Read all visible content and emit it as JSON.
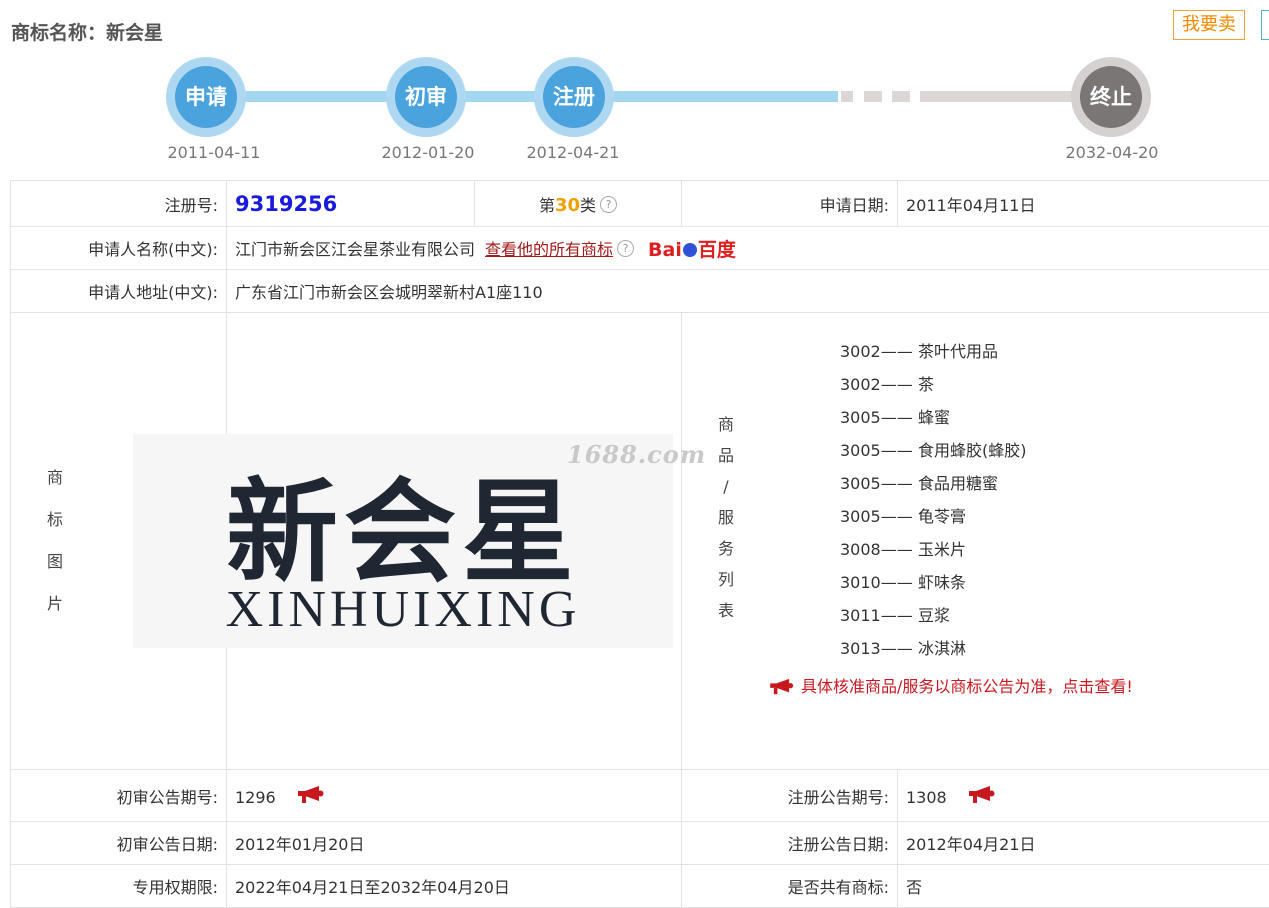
{
  "header": {
    "title": "商标名称：新会星",
    "sell_button": "我要卖"
  },
  "timeline": {
    "nodes": [
      {
        "label": "申请",
        "date": "2011-04-11",
        "state": "done"
      },
      {
        "label": "初审",
        "date": "2012-01-20",
        "state": "done"
      },
      {
        "label": "注册",
        "date": "2012-04-21",
        "state": "done"
      },
      {
        "label": "终止",
        "date": "2032-04-20",
        "state": "future"
      }
    ]
  },
  "info": {
    "reg_no_label": "注册号:",
    "reg_no": "9319256",
    "class_prefix": "第",
    "class_num": "30",
    "class_suffix": "类",
    "apply_date_label": "申请日期:",
    "apply_date": "2011年04月11日",
    "applicant_label": "申请人名称(中文):",
    "applicant": "江门市新会区江会星茶业有限公司",
    "view_all_link": "查看他的所有商标",
    "baidu_left": "Bai",
    "baidu_right": "百度",
    "address_label": "申请人地址(中文):",
    "address": "广东省江门市新会区会城明翠新村A1座110",
    "logo_label_chars": [
      "商",
      "标",
      "图",
      "片"
    ],
    "logo_cn": "新会星",
    "logo_en": "XINHUIXING",
    "watermark": "1688.com",
    "services_label_chars": [
      "商",
      "品",
      "/",
      "服",
      "务",
      "列",
      "表"
    ],
    "services": [
      {
        "code": "3002——",
        "name": "茶叶代用品"
      },
      {
        "code": "3002——",
        "name": "茶"
      },
      {
        "code": "3005——",
        "name": "蜂蜜"
      },
      {
        "code": "3005——",
        "name": "食用蜂胶(蜂胶)"
      },
      {
        "code": "3005——",
        "name": "食品用糖蜜"
      },
      {
        "code": "3005——",
        "name": "龟苓膏"
      },
      {
        "code": "3008——",
        "name": "玉米片"
      },
      {
        "code": "3010——",
        "name": "虾味条"
      },
      {
        "code": "3011——",
        "name": "豆浆"
      },
      {
        "code": "3013——",
        "name": "冰淇淋"
      }
    ],
    "services_notice": "具体核准商品/服务以商标公告为准，点击查看!",
    "prelim_issue_label": "初审公告期号:",
    "prelim_issue": "1296",
    "reg_issue_label": "注册公告期号:",
    "reg_issue": "1308",
    "prelim_date_label": "初审公告日期:",
    "prelim_date": "2012年01月20日",
    "reg_date_label": "注册公告日期:",
    "reg_date": "2012年04月21日",
    "exclusive_label": "专用权期限:",
    "exclusive": "2022年04月21日至2032年04月20日",
    "shared_label": "是否共有商标:",
    "shared": "否"
  },
  "colors": {
    "done_node": "#4aa3dc",
    "future_node": "#7b7676",
    "reg_no": "#1a1adb",
    "notice": "#c8181f"
  }
}
